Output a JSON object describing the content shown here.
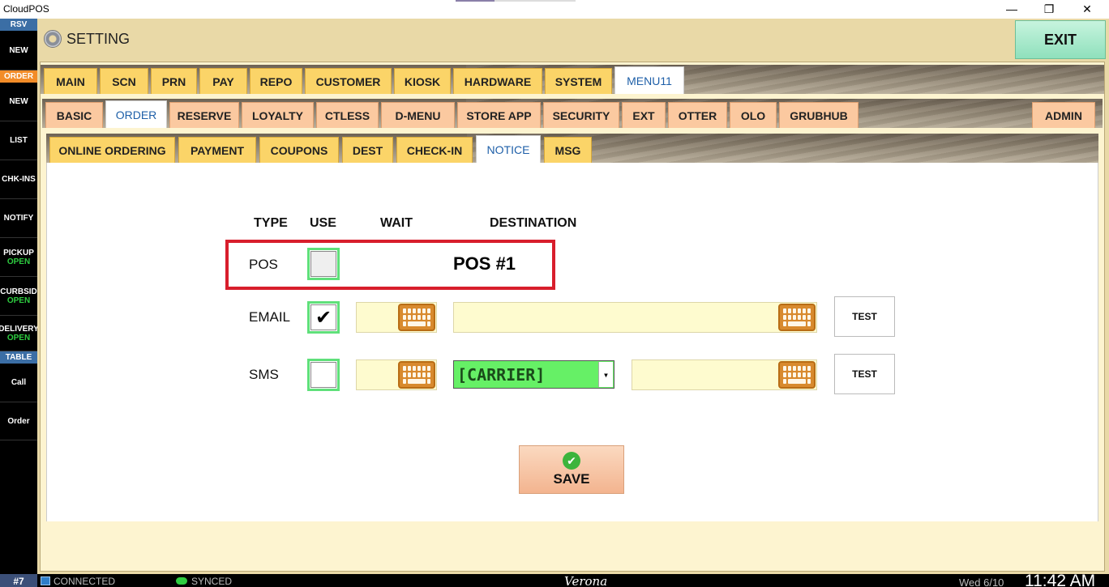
{
  "window": {
    "title": "CloudPOS",
    "minimize": "—",
    "restore": "❐",
    "close": "✕"
  },
  "sidebar": {
    "rsv_header": "RSV",
    "rsv_new": "NEW",
    "order_header": "ORDER",
    "order_items": [
      {
        "label": "NEW"
      },
      {
        "label": "LIST"
      },
      {
        "label": "CHK-INS"
      },
      {
        "label": "NOTIFY"
      },
      {
        "label": "PICKUP",
        "sub": "OPEN"
      },
      {
        "label": "CURBSID",
        "sub": "OPEN"
      },
      {
        "label": "DELIVERY",
        "sub": "OPEN"
      }
    ],
    "table_header": "TABLE",
    "table_items": [
      {
        "label": "Call"
      },
      {
        "label": "Order"
      }
    ],
    "colors": {
      "rsv": "#3b6ea5",
      "order": "#f28c28",
      "table": "#3b6ea5",
      "open": "#2ecc40"
    }
  },
  "header": {
    "title": "SETTING",
    "exit_label": "EXIT"
  },
  "tabs_row1": [
    {
      "label": "MAIN"
    },
    {
      "label": "SCN"
    },
    {
      "label": "PRN"
    },
    {
      "label": "PAY"
    },
    {
      "label": "REPO"
    },
    {
      "label": "CUSTOMER"
    },
    {
      "label": "KIOSK"
    },
    {
      "label": "HARDWARE"
    },
    {
      "label": "SYSTEM"
    },
    {
      "label": "MENU11",
      "active": true
    }
  ],
  "tabs_row2": [
    {
      "label": "BASIC"
    },
    {
      "label": "ORDER",
      "active": true
    },
    {
      "label": "RESERVE"
    },
    {
      "label": "LOYALTY"
    },
    {
      "label": "CTLESS"
    },
    {
      "label": "D-MENU"
    },
    {
      "label": "STORE APP"
    },
    {
      "label": "SECURITY"
    },
    {
      "label": "EXT"
    },
    {
      "label": "OTTER"
    },
    {
      "label": "OLO"
    },
    {
      "label": "GRUBHUB"
    },
    {
      "label": "ADMIN"
    }
  ],
  "tabs_row3": [
    {
      "label": "ONLINE ORDERING"
    },
    {
      "label": "PAYMENT"
    },
    {
      "label": "COUPONS"
    },
    {
      "label": "DEST"
    },
    {
      "label": "CHECK-IN"
    },
    {
      "label": "NOTICE",
      "active": true
    },
    {
      "label": "MSG"
    }
  ],
  "notice": {
    "columns": {
      "type": "TYPE",
      "use": "USE",
      "wait": "WAIT",
      "destination": "DESTINATION"
    },
    "rows": {
      "pos": {
        "type": "POS",
        "checked": false,
        "destination": "POS #1"
      },
      "email": {
        "type": "EMAIL",
        "checked": true,
        "wait": "",
        "destination": "",
        "test_label": "TEST"
      },
      "sms": {
        "type": "SMS",
        "checked": false,
        "wait": "",
        "carrier": "[CARRIER]",
        "destination": "",
        "test_label": "TEST"
      }
    },
    "save_label": "SAVE",
    "check_mark": "✔"
  },
  "statusbar": {
    "terminal": "#7",
    "connection": "CONNECTED",
    "sync": "SYNCED",
    "store": "Verona",
    "date": "Wed 6/10",
    "time": "11:42 AM"
  }
}
